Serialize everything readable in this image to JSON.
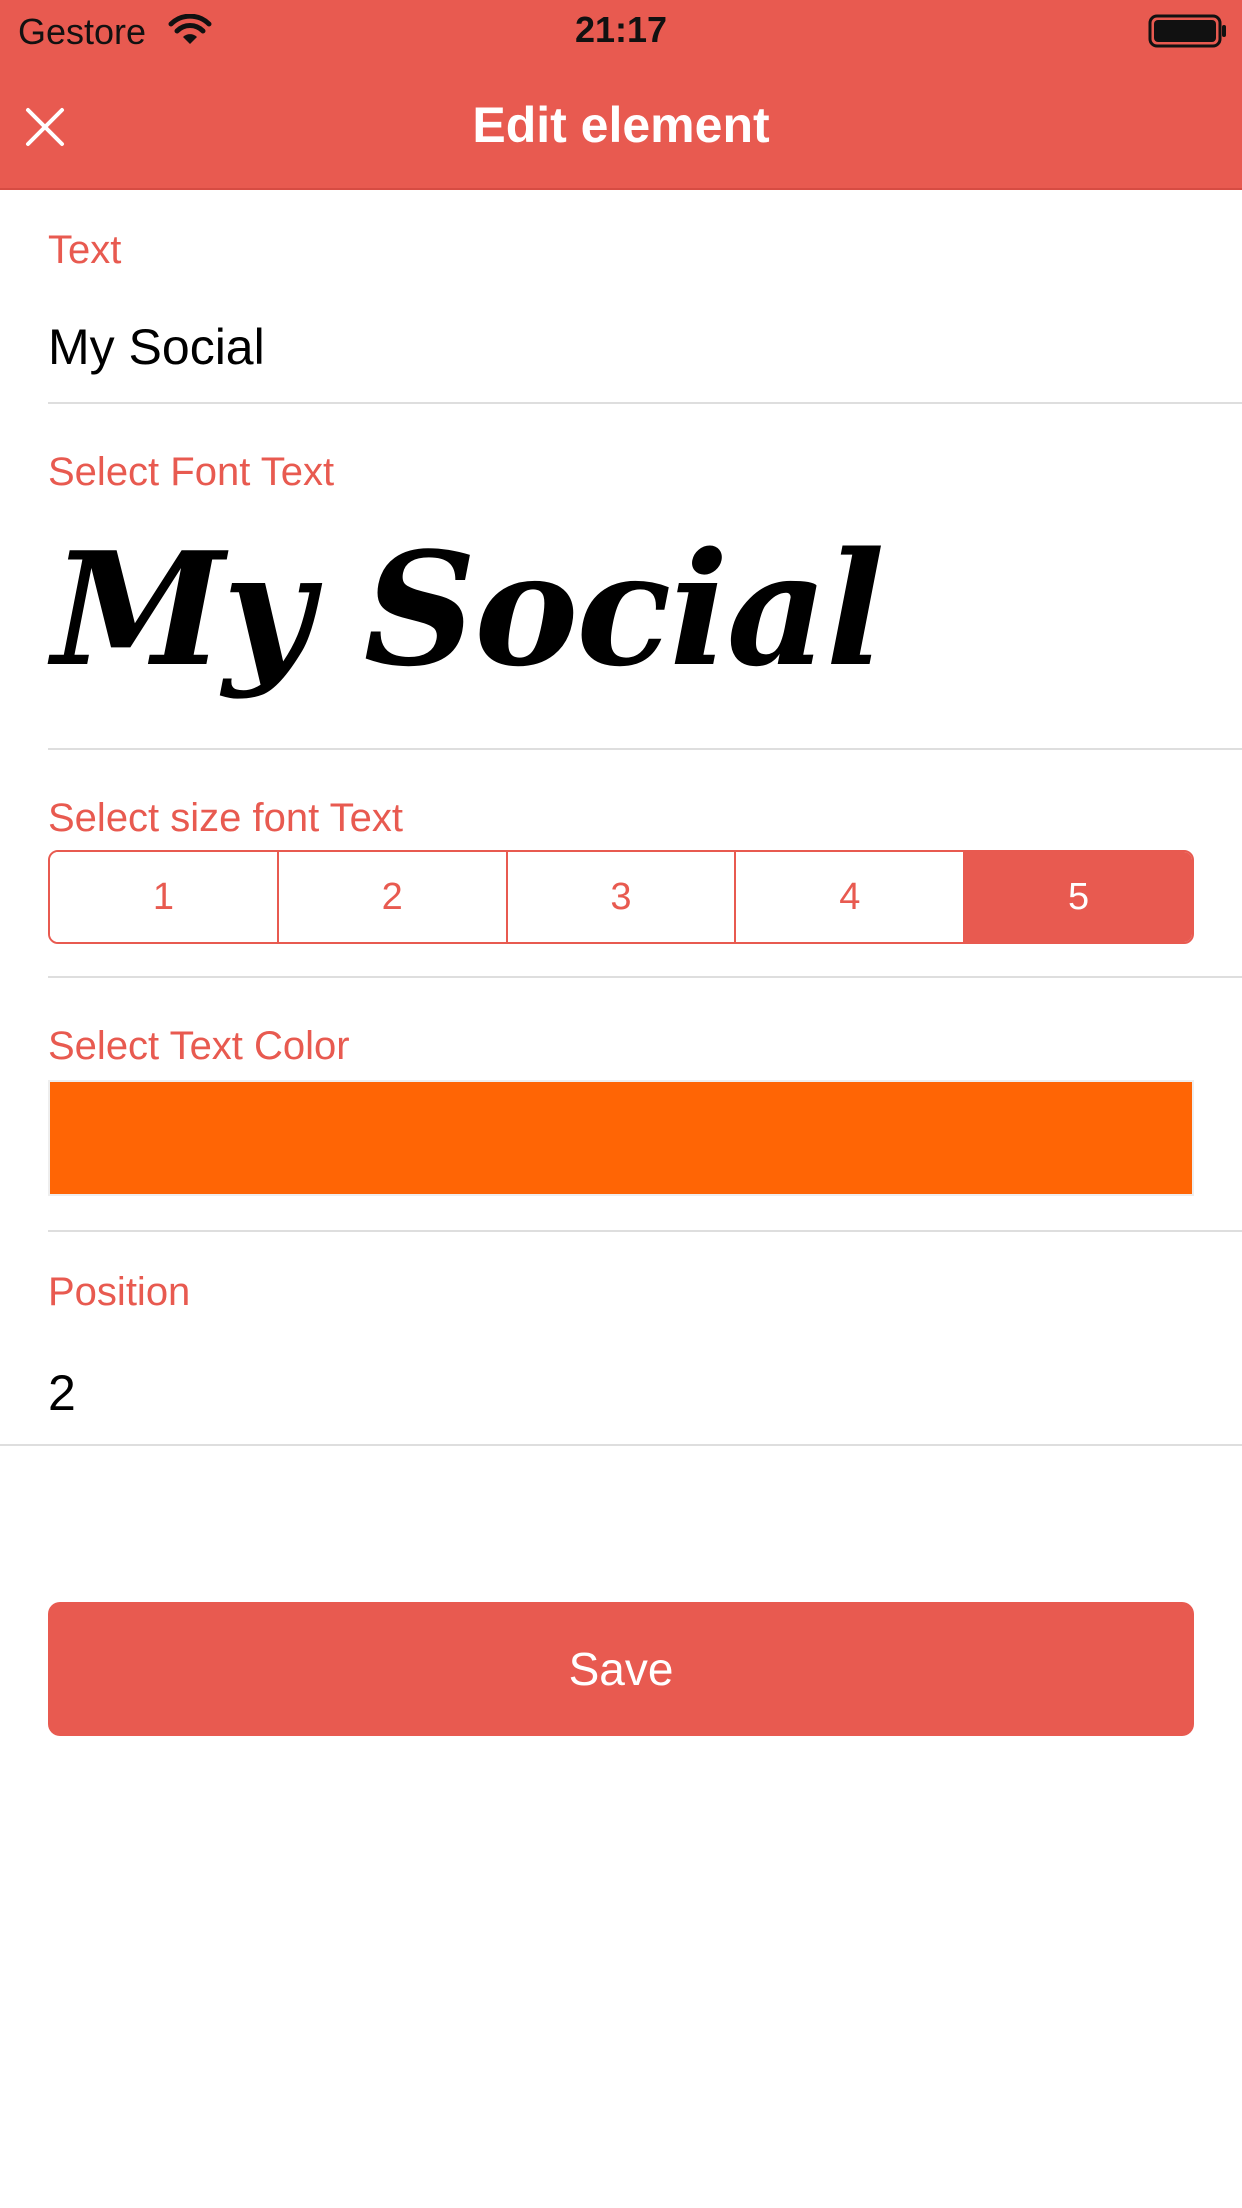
{
  "colors": {
    "accent": "#e85a50",
    "selected_text_color": "#ff6505",
    "divider": "#dedede"
  },
  "status_bar": {
    "carrier": "Gestore",
    "time": "21:17",
    "wifi_icon": "wifi-icon",
    "battery_icon": "battery-icon"
  },
  "nav": {
    "title": "Edit element",
    "close_icon": "close-icon"
  },
  "text_section": {
    "label": "Text",
    "value": "My Social"
  },
  "font_section": {
    "label": "Select Font Text",
    "preview": "My Social"
  },
  "size_section": {
    "label": "Select size font Text",
    "options": [
      "1",
      "2",
      "3",
      "4",
      "5"
    ],
    "selected": "5"
  },
  "color_section": {
    "label": "Select Text Color",
    "value": "#ff6505"
  },
  "position_section": {
    "label": "Position",
    "value": "2"
  },
  "save_button": {
    "label": "Save"
  }
}
